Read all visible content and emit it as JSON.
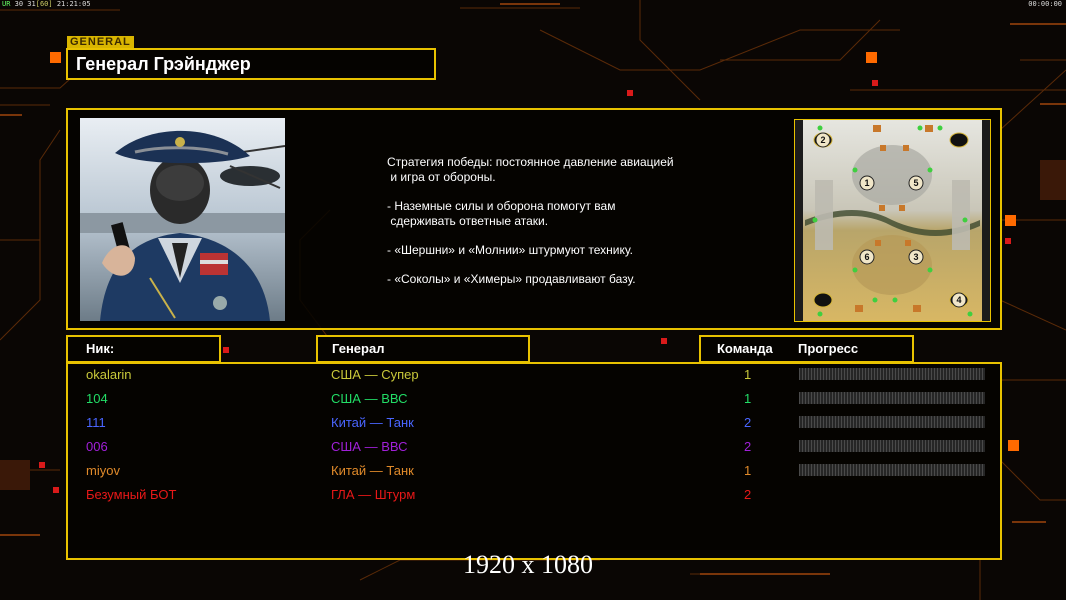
{
  "topbar": {
    "left_a": "UR",
    "left_b": "30 31",
    "left_c": "[60]",
    "time": "21:21:05",
    "clock": "00:00:00"
  },
  "header": {
    "tag": "GENERAL",
    "general_name": "Генерал Грэйнджер"
  },
  "strategy": [
    "Стратегия победы: постоянное давление авиацией\n и игра от обороны.",
    "- Наземные силы и оборона помогут вам\n сдерживать ответные атаки.",
    "- «Шершни» и «Молнии» штурмуют технику.",
    "- «Соколы» и «Химеры» продавливают базу."
  ],
  "minimap": {
    "start_positions": [
      "1",
      "2",
      "3",
      "4",
      "5",
      "6"
    ]
  },
  "columns": {
    "nick": "Ник:",
    "general": "Генерал",
    "team": "Команда",
    "progress": "Прогресс"
  },
  "colors": {
    "accent": "#e8c200"
  },
  "players": [
    {
      "nick": "okalarin",
      "general": "США — Супер",
      "team": "1",
      "color": "#c9c93a",
      "progress": 0
    },
    {
      "nick": "104",
      "general": "США — ВВС",
      "team": "1",
      "color": "#22dd66",
      "progress": 0
    },
    {
      "nick": "111",
      "general": "Китай — Танк",
      "team": "2",
      "color": "#4a66ff",
      "progress": 0
    },
    {
      "nick": "006",
      "general": "США — ВВС",
      "team": "2",
      "color": "#a020d8",
      "progress": 0
    },
    {
      "nick": "miyov",
      "general": "Китай — Танк",
      "team": "1",
      "color": "#e08a2a",
      "progress": 0
    },
    {
      "nick": "Безумный БОТ",
      "general": "ГЛА — Штурм",
      "team": "2",
      "color": "#e81818",
      "progress": null
    }
  ],
  "resolution": "1920 x 1080"
}
